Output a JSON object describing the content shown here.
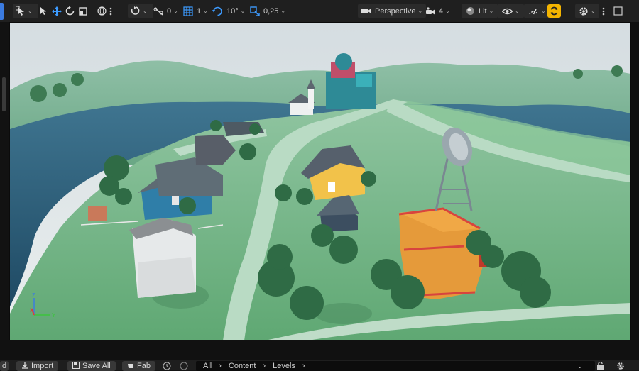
{
  "toolbar": {
    "transform_snap_value": "0",
    "grid_snap_value": "1",
    "rotation_snap_value": "10°",
    "scale_snap_value": "0,25",
    "view_mode_label": "Perspective",
    "camera_speed": "4",
    "lit_label": "Lit"
  },
  "bottom": {
    "left_tab_fragment": "d",
    "import_label": "Import",
    "save_all_label": "Save All",
    "fab_label": "Fab",
    "path": [
      "All",
      "Content",
      "Levels"
    ]
  },
  "colors": {
    "accent_blue": "#3d9bff",
    "snap_yellow": "#f4b400",
    "toolbar_bg": "#1f1f1f"
  },
  "icons": [
    "select-mode-icon",
    "select-arrow-icon",
    "move-icon",
    "rotate-icon",
    "scale-icon",
    "world-icon",
    "more-icon",
    "snap-surface-icon",
    "transform-snap-icon",
    "grid-snap-icon",
    "rotation-snap-icon",
    "scale-snap-icon",
    "camera-icon",
    "camera-speed-icon",
    "lit-sphere-icon",
    "eye-icon",
    "realtime-icon",
    "snap-toggle-icon",
    "settings-icon",
    "layout-icon"
  ]
}
